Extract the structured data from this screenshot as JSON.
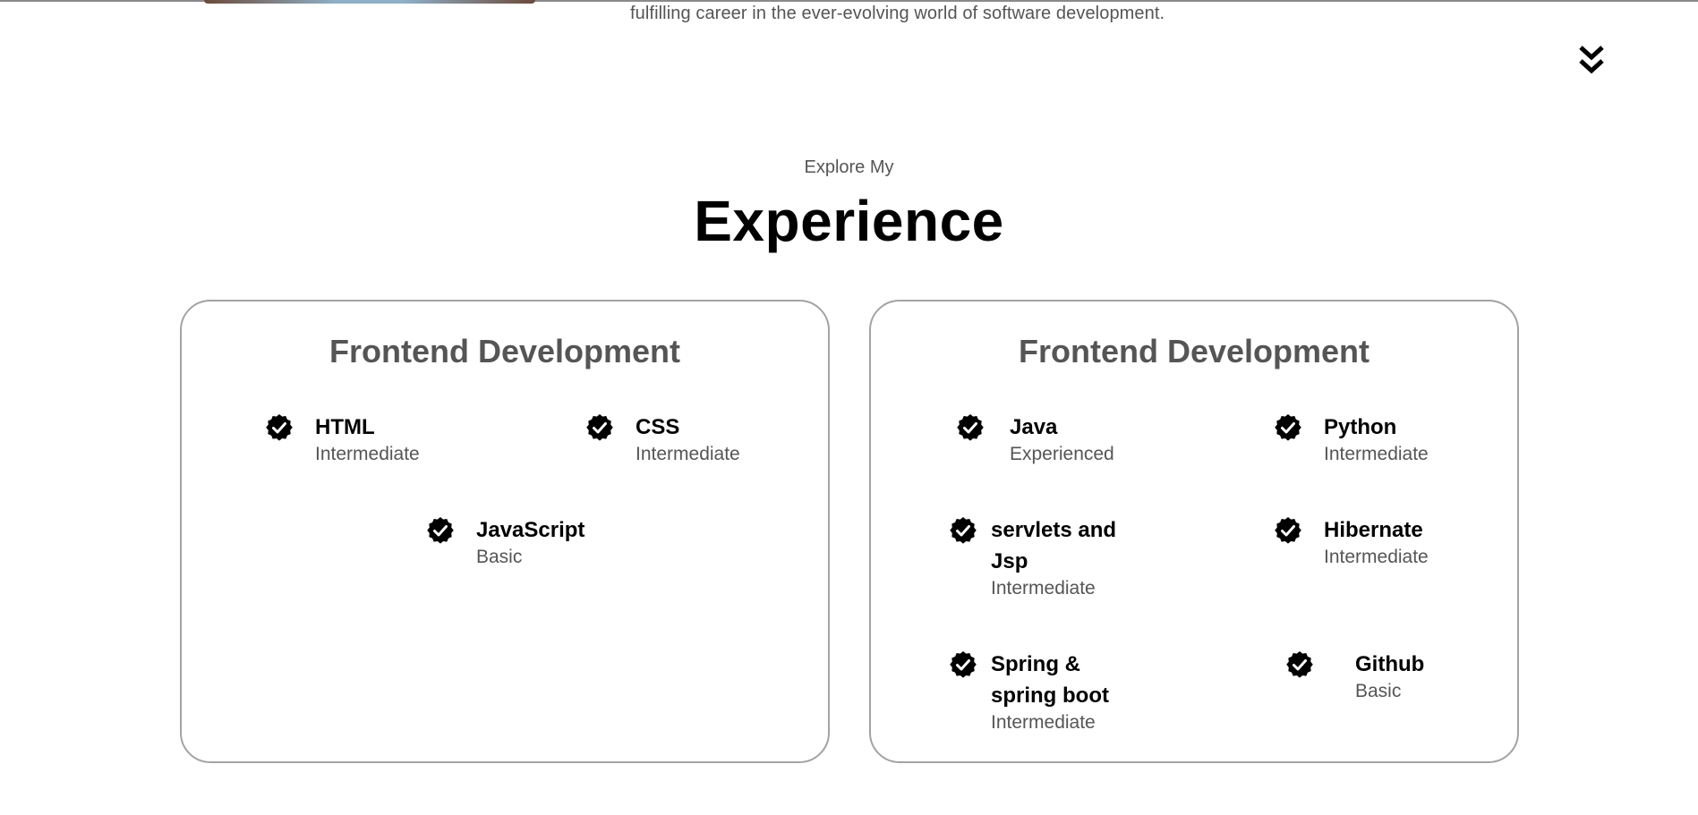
{
  "about": {
    "intro_text": "fulfilling career in the ever-evolving world of software development."
  },
  "navigation": {
    "scroll_icon": "double-chevron-down-icon"
  },
  "experience": {
    "eyebrow": "Explore My",
    "title": "Experience",
    "badge_icon": "verified-check-badge-icon",
    "cards": [
      {
        "title": "Frontend Development",
        "skills": [
          {
            "name": "HTML",
            "level": "Intermediate"
          },
          {
            "name": "CSS",
            "level": "Intermediate"
          },
          {
            "name": "JavaScript",
            "level": "Basic"
          }
        ]
      },
      {
        "title": "Frontend Development",
        "skills": [
          {
            "name": "Java",
            "level": "Experienced"
          },
          {
            "name": "Python",
            "level": "Intermediate"
          },
          {
            "name": "servlets and",
            "name_line2": "Jsp",
            "level": "Intermediate"
          },
          {
            "name": "Hibernate",
            "level": "Intermediate"
          },
          {
            "name": "Spring &",
            "name_line2": "spring boot",
            "level": "Intermediate"
          },
          {
            "name": "Github",
            "level": "Basic"
          }
        ]
      }
    ]
  },
  "colors": {
    "text_primary": "#000000",
    "text_secondary": "#555555",
    "card_border": "#a3a3a3",
    "badge": "#000000"
  }
}
